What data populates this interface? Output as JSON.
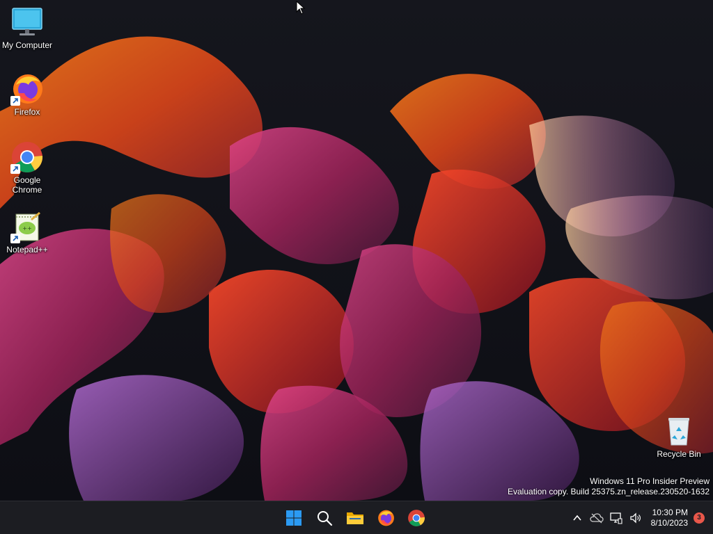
{
  "desktop": {
    "icons": [
      {
        "label": "My Computer",
        "icon": "monitor-icon",
        "shortcut": false
      },
      {
        "label": "Firefox",
        "icon": "firefox-icon",
        "shortcut": true
      },
      {
        "label": "Google Chrome",
        "icon": "chrome-icon",
        "shortcut": true
      },
      {
        "label": "Notepad++",
        "icon": "notepad-plus-plus-icon",
        "shortcut": true
      },
      {
        "label": "Recycle Bin",
        "icon": "recycle-bin-icon",
        "shortcut": false
      }
    ]
  },
  "watermark": {
    "line1": "Windows 11 Pro Insider Preview",
    "line2": "Evaluation copy. Build 25375.zn_release.230520-1632"
  },
  "taskbar": {
    "apps": [
      {
        "name": "Start",
        "icon": "windows-start-icon"
      },
      {
        "name": "Search",
        "icon": "search-icon"
      },
      {
        "name": "File Explorer",
        "icon": "folder-icon"
      },
      {
        "name": "Firefox",
        "icon": "firefox-icon"
      },
      {
        "name": "Google Chrome",
        "icon": "chrome-icon"
      }
    ],
    "tray": {
      "icons": [
        "chevron-up-icon",
        "cloud-offline-icon",
        "network-icon",
        "volume-icon"
      ],
      "time": "10:30 PM",
      "date": "8/10/2023",
      "notification_count": "3"
    }
  },
  "colors": {
    "taskbar_bg": "#1c1d22",
    "start_blue": "#2b9af3",
    "badge": "#e8574a"
  }
}
